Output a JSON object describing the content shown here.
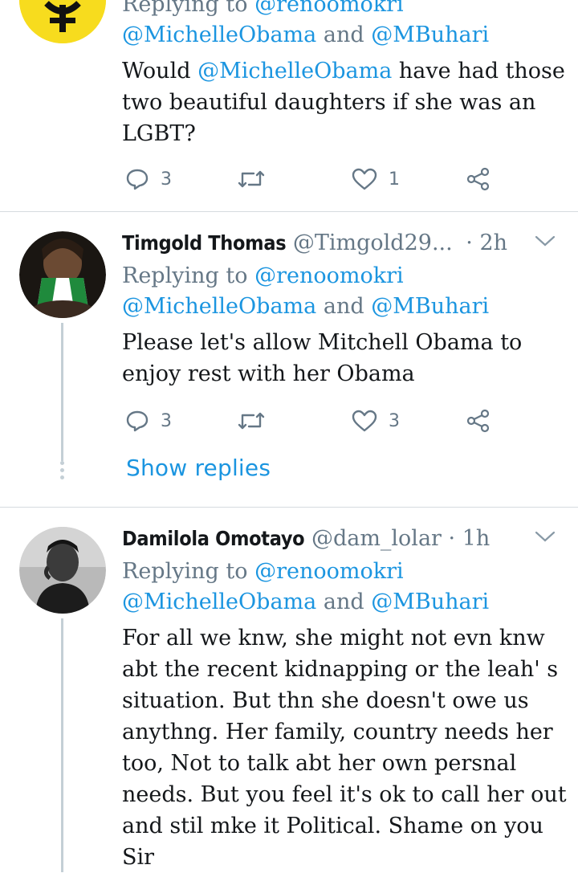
{
  "tweets": [
    {
      "reply_prefix": "Replying to",
      "reply_handle": "@renoomokri",
      "mentions": {
        "a": "@MichelleObama",
        "and": "and",
        "b": "@MBuhari"
      },
      "body_lines": [
        "Would ",
        "@MichelleObama",
        " have had those",
        "two beautiful daughters if she was an",
        "LGBT?"
      ],
      "replies": "3",
      "likes": "1"
    },
    {
      "name": "Timgold Thomas",
      "handle": "@Timgold29...",
      "time": "· 2h",
      "reply_prefix": "Replying to",
      "reply_handle": "@renoomokri",
      "mentions": {
        "a": "@MichelleObama",
        "and": "and",
        "b": "@MBuhari"
      },
      "body_lines": [
        "Please let's allow Mitchell Obama to",
        "enjoy rest with her Obama"
      ],
      "replies": "3",
      "likes": "3",
      "show_replies": "Show replies"
    },
    {
      "name": "Damilola Omotayo",
      "handle": "@dam_lolar",
      "time": "· 1h",
      "reply_prefix": "Replying to",
      "reply_handle": "@renoomokri",
      "mentions": {
        "a": "@MichelleObama",
        "and": "and",
        "b": "@MBuhari"
      },
      "body_lines": [
        "For all we knw, she might not evn knw",
        "abt the recent kidnapping or the leah' s",
        "situation. But thn she doesn't owe us",
        "anythng. Her family, country needs her",
        "too, Not to talk abt her own persnal",
        "needs. But you feel it's ok to call her out",
        "and stil mke it Political. Shame on you",
        "Sir"
      ]
    }
  ],
  "colors": {
    "link": "#1b95e0",
    "muted": "#657786",
    "divider": "#d6dbdf",
    "thread": "#c4cfd6"
  },
  "icons": [
    "reply-icon",
    "retweet-icon",
    "like-icon",
    "share-icon",
    "chevron-down-icon"
  ]
}
